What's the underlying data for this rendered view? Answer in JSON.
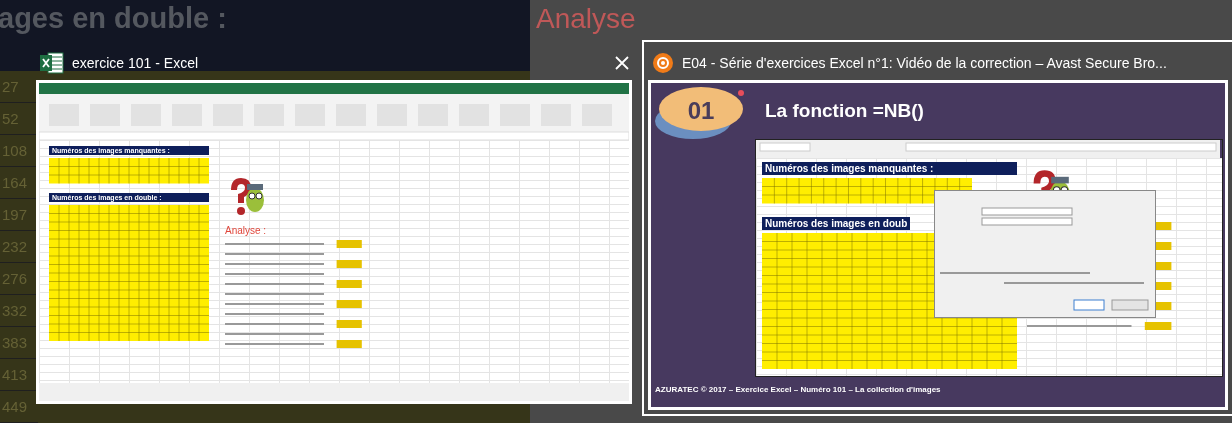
{
  "backdrop": {
    "heading": "ages en double :",
    "analysis_heading": "Analyse",
    "column_numbers": [
      "27",
      "52",
      "108",
      "164",
      "197",
      "232",
      "276",
      "332",
      "383",
      "413",
      "449"
    ]
  },
  "windows": [
    {
      "kind": "excel",
      "title": "exercice 101 - Excel",
      "selected": false,
      "close_visible": true,
      "thumbnail": {
        "headings": [
          "Numéros des images manquantes :",
          "Numéros des images en double :"
        ],
        "analysis_title": "Analyse :"
      }
    },
    {
      "kind": "browser",
      "title": "E04 - Série d'exercices Excel n°1: Vidéo de la correction – Avast Secure Bro...",
      "selected": true,
      "close_visible": false,
      "thumbnail": {
        "badge": "01",
        "slide_title": "La fonction =NB()",
        "headings": [
          "Numéros des images manquantes :",
          "Numéros des images en doub"
        ],
        "footer": "AZURATEC © 2017 – Exercice Excel – Numéro 101 – La collection d'images"
      }
    }
  ]
}
